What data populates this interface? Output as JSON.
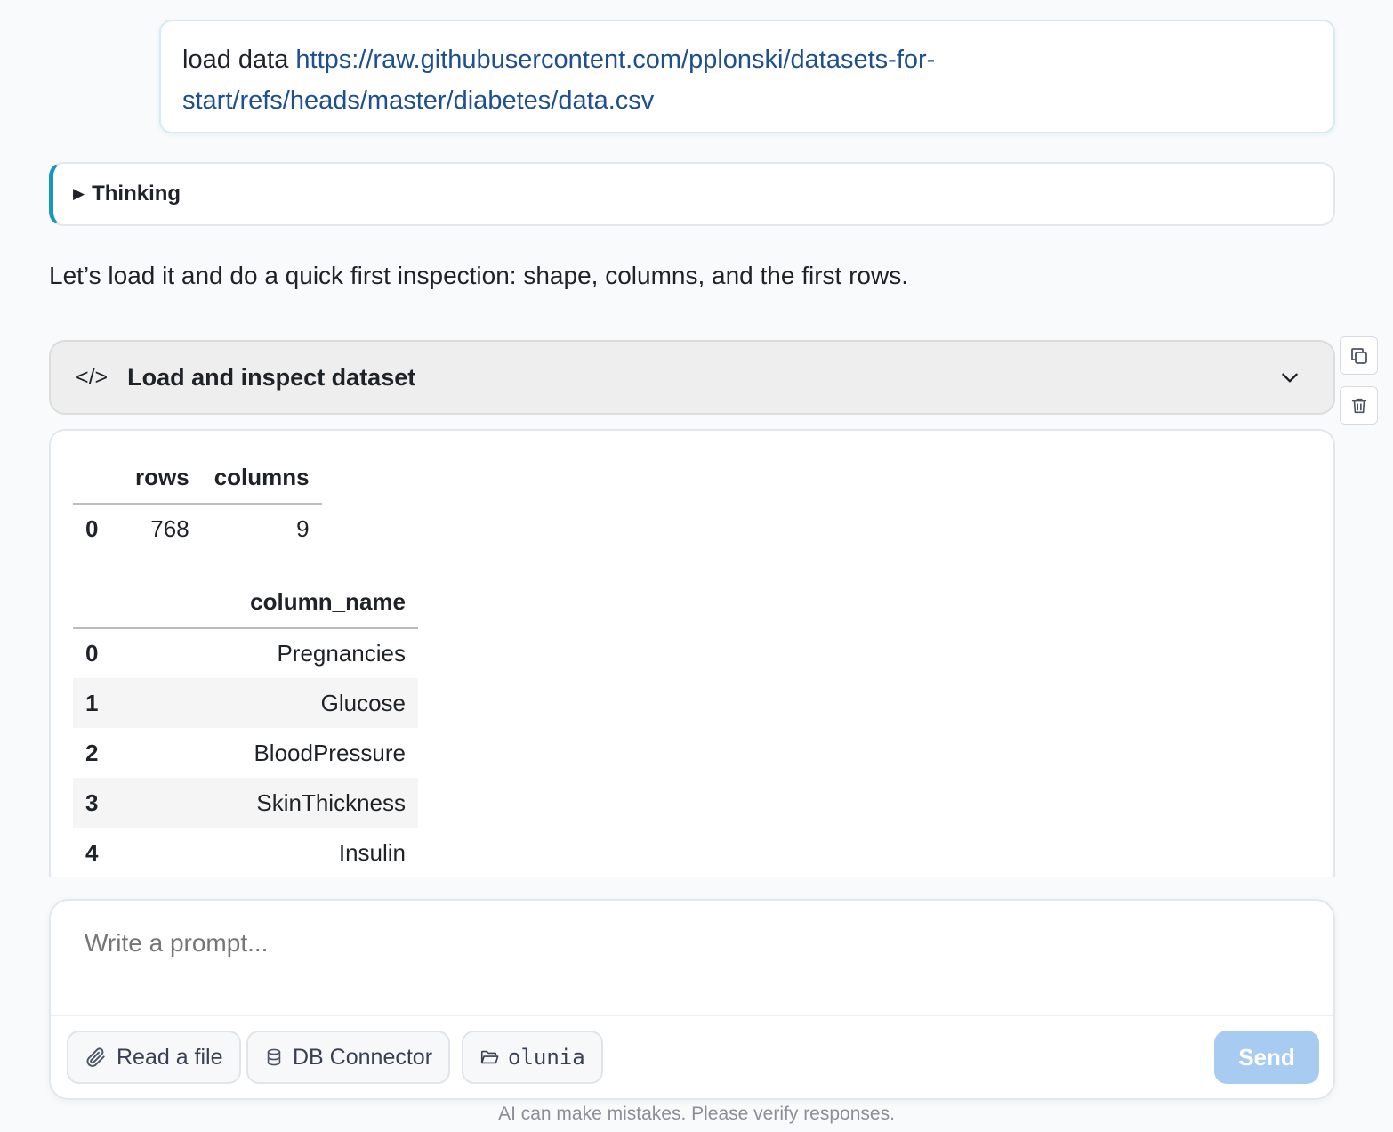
{
  "user_message": {
    "prefix": "load data ",
    "link_text": "https://raw.githubusercontent.com/pplonski/datasets-for-start/refs/heads/master/diabetes/data.csv"
  },
  "thinking": {
    "label": "Thinking",
    "icon": "triangle-right-icon"
  },
  "assistant_text": "Let’s load it and do a quick first inspection: shape, columns, and the first rows.",
  "code_block": {
    "icon": "</>",
    "title": "Load and inspect dataset"
  },
  "side_actions": {
    "copy": "copy-icon",
    "delete": "trash-icon"
  },
  "shape_table": {
    "headers": [
      "",
      "rows",
      "columns"
    ],
    "rows": [
      {
        "index": "0",
        "rows": "768",
        "columns": "9"
      }
    ]
  },
  "columns_table": {
    "header": "column_name",
    "rows": [
      {
        "index": "0",
        "value": "Pregnancies"
      },
      {
        "index": "1",
        "value": "Glucose"
      },
      {
        "index": "2",
        "value": "BloodPressure"
      },
      {
        "index": "3",
        "value": "SkinThickness"
      },
      {
        "index": "4",
        "value": "Insulin"
      }
    ]
  },
  "composer": {
    "placeholder": "Write a prompt...",
    "read_file_label": "Read a file",
    "db_connector_label": "DB Connector",
    "folder_label": "olunia",
    "send_label": "Send"
  },
  "disclaimer": "AI can make mistakes. Please verify responses.",
  "colors": {
    "link": "#1d4f91",
    "thinking_accent": "#1697c2",
    "send_disabled": "#a8cbf2"
  }
}
